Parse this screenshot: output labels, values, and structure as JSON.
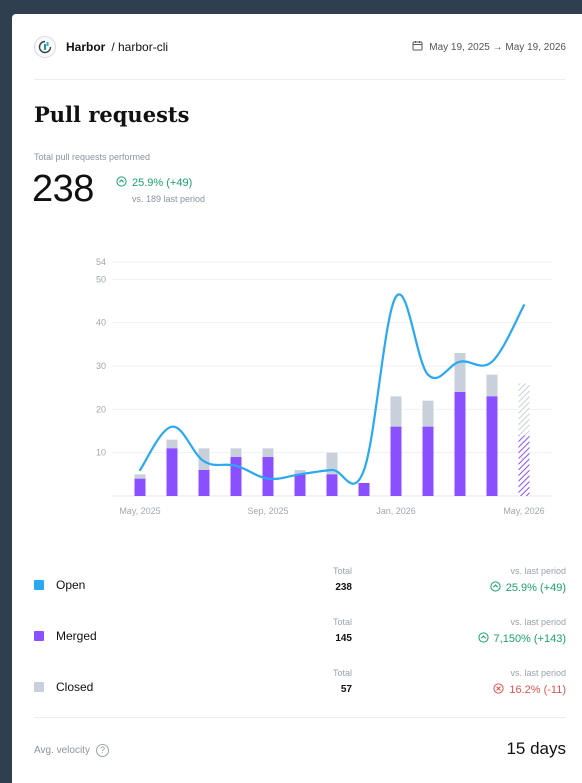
{
  "header": {
    "org": "Harbor",
    "repo": "/ harbor-cli",
    "date_range": "May 19, 2025 → May 19, 2026",
    "calendar_icon": "calendar-icon",
    "logo_icon": "harbor-logo-icon"
  },
  "title": "Pull requests",
  "kpi": {
    "label": "Total pull requests performed",
    "value": "238",
    "change": "25.9% (+49)",
    "sub": "vs. 189 last period"
  },
  "colors": {
    "open": "#2aa8f2",
    "merged": "#8a4fff",
    "closed": "#c8d1db",
    "positive": "#1aa36b",
    "negative": "#e05252"
  },
  "chart_data": {
    "type": "bar",
    "categories": [
      "May, 2025",
      "Jun, 2025",
      "Jul, 2025",
      "Aug, 2025",
      "Sep, 2025",
      "Oct, 2025",
      "Nov, 2025",
      "Dec, 2025",
      "Jan, 2026",
      "Feb, 2026",
      "Mar, 2026",
      "Apr, 2026",
      "May, 2026"
    ],
    "x_tick_labels": [
      "May, 2025",
      "Sep, 2025",
      "Jan, 2026",
      "May, 2026"
    ],
    "y_ticks": [
      10,
      20,
      30,
      40,
      50,
      54
    ],
    "ylim": [
      0,
      54
    ],
    "grid": true,
    "series": [
      {
        "name": "Merged",
        "kind": "bar",
        "values": [
          4,
          11,
          6,
          9,
          9,
          5,
          5,
          3,
          16,
          16,
          24,
          23,
          14
        ]
      },
      {
        "name": "Closed",
        "kind": "bar-stacked",
        "values": [
          1,
          2,
          5,
          2,
          2,
          1,
          5,
          0,
          7,
          6,
          9,
          5,
          12
        ]
      },
      {
        "name": "Open",
        "kind": "line",
        "values": [
          6,
          16,
          8,
          7,
          4,
          5,
          6,
          6,
          46,
          28,
          31,
          31,
          44
        ]
      }
    ],
    "last_bar_partial": true
  },
  "legend": {
    "total_label": "Total",
    "cmp_label": "vs. last period",
    "items": [
      {
        "name": "Open",
        "total": "238",
        "change": "25.9% (+49)",
        "trend": "up"
      },
      {
        "name": "Merged",
        "total": "145",
        "change": "7,150% (+143)",
        "trend": "up"
      },
      {
        "name": "Closed",
        "total": "57",
        "change": "16.2% (-11)",
        "trend": "down"
      }
    ]
  },
  "footer": {
    "avg_label": "Avg. velocity",
    "avg_value": "15 days"
  }
}
